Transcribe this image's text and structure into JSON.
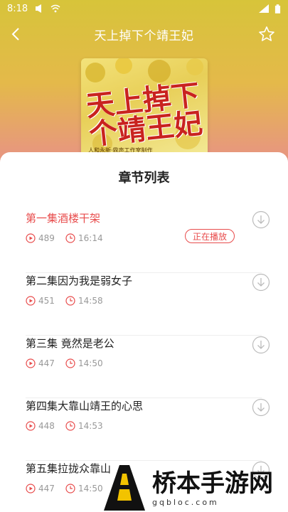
{
  "statusbar": {
    "time": "8:18"
  },
  "header": {
    "title": "天上掉下个靖王妃"
  },
  "cover": {
    "title": "天上掉下个靖王妃",
    "subtitle": "人和永新·鼎声工作室制作"
  },
  "sheet": {
    "title": "章节列表"
  },
  "chapters": [
    {
      "title": "第一集酒楼干架",
      "plays": "489",
      "duration": "16:14",
      "status": "正在播放"
    },
    {
      "title": "第二集因为我是弱女子",
      "plays": "451",
      "duration": "14:58"
    },
    {
      "title": "第三集 竟然是老公",
      "plays": "447",
      "duration": "14:50"
    },
    {
      "title": "第四集大靠山靖王的心思",
      "plays": "448",
      "duration": "14:53"
    },
    {
      "title": "第五集拉拢众靠山",
      "plays": "447",
      "duration": "14:50"
    }
  ],
  "watermark": {
    "name": "桥本手游网",
    "url": "gqbloc.com"
  },
  "colors": {
    "accent": "#e84c4c",
    "meta": "#999999"
  }
}
